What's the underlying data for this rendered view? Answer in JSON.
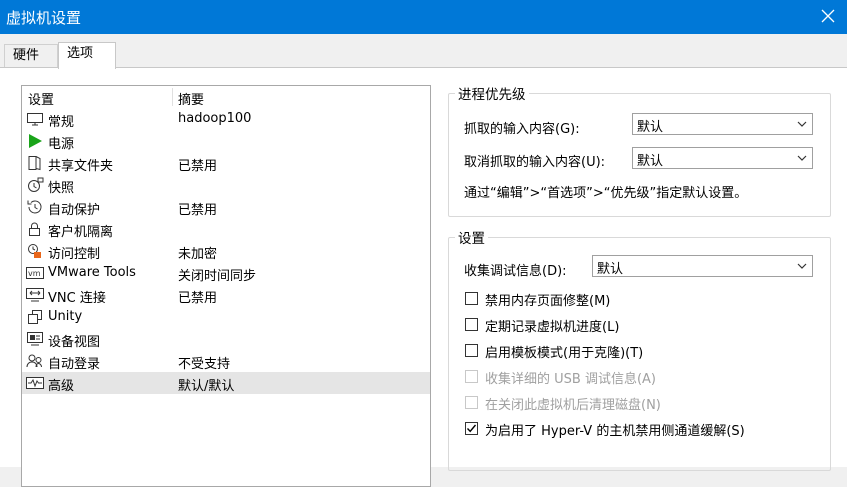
{
  "window": {
    "title": "虚拟机设置"
  },
  "tabs": [
    {
      "label": "硬件",
      "active": false
    },
    {
      "label": "选项",
      "active": true
    }
  ],
  "list": {
    "headers": {
      "setting": "设置",
      "summary": "摘要"
    },
    "items": [
      {
        "name": "常规",
        "summary": "hadoop100",
        "icon": "monitor-icon"
      },
      {
        "name": "电源",
        "summary": "",
        "icon": "play-icon"
      },
      {
        "name": "共享文件夹",
        "summary": "已禁用",
        "icon": "shared-folder-icon"
      },
      {
        "name": "快照",
        "summary": "",
        "icon": "snapshot-icon"
      },
      {
        "name": "自动保护",
        "summary": "已禁用",
        "icon": "autoprotect-icon"
      },
      {
        "name": "客户机隔离",
        "summary": "",
        "icon": "lock-icon"
      },
      {
        "name": "访问控制",
        "summary": "未加密",
        "icon": "access-control-icon"
      },
      {
        "name": "VMware Tools",
        "summary": "关闭时间同步",
        "icon": "vm-icon"
      },
      {
        "name": "VNC 连接",
        "summary": "已禁用",
        "icon": "vnc-icon"
      },
      {
        "name": "Unity",
        "summary": "",
        "icon": "unity-icon"
      },
      {
        "name": "设备视图",
        "summary": "",
        "icon": "device-view-icon"
      },
      {
        "name": "自动登录",
        "summary": "不受支持",
        "icon": "users-icon"
      },
      {
        "name": "高级",
        "summary": "默认/默认",
        "icon": "advanced-icon",
        "selected": true
      }
    ]
  },
  "priority": {
    "legend": "进程优先级",
    "grabbed_label": "抓取的输入内容(G):",
    "grabbed_value": "默认",
    "ungrabbed_label": "取消抓取的输入内容(U):",
    "ungrabbed_value": "默认",
    "hint": "通过“编辑”>“首选项”>“优先级”指定默认设置。"
  },
  "settings": {
    "legend": "设置",
    "debug_label": "收集调试信息(D):",
    "debug_value": "默认",
    "checkboxes": [
      {
        "label": "禁用内存页面修整(M)",
        "checked": false,
        "disabled": false
      },
      {
        "label": "定期记录虚拟机进度(L)",
        "checked": false,
        "disabled": false
      },
      {
        "label": "启用模板模式(用于克隆)(T)",
        "checked": false,
        "disabled": false
      },
      {
        "label": "收集详细的 USB 调试信息(A)",
        "checked": false,
        "disabled": true
      },
      {
        "label": "在关闭此虚拟机后清理磁盘(N)",
        "checked": false,
        "disabled": true
      },
      {
        "label": "为启用了 Hyper-V 的主机禁用侧通道缓解(S)",
        "checked": true,
        "disabled": false
      }
    ]
  },
  "colors": {
    "titlebar": "#0078d7",
    "play": "#1aa41a",
    "lock_accent": "#e8661a"
  }
}
